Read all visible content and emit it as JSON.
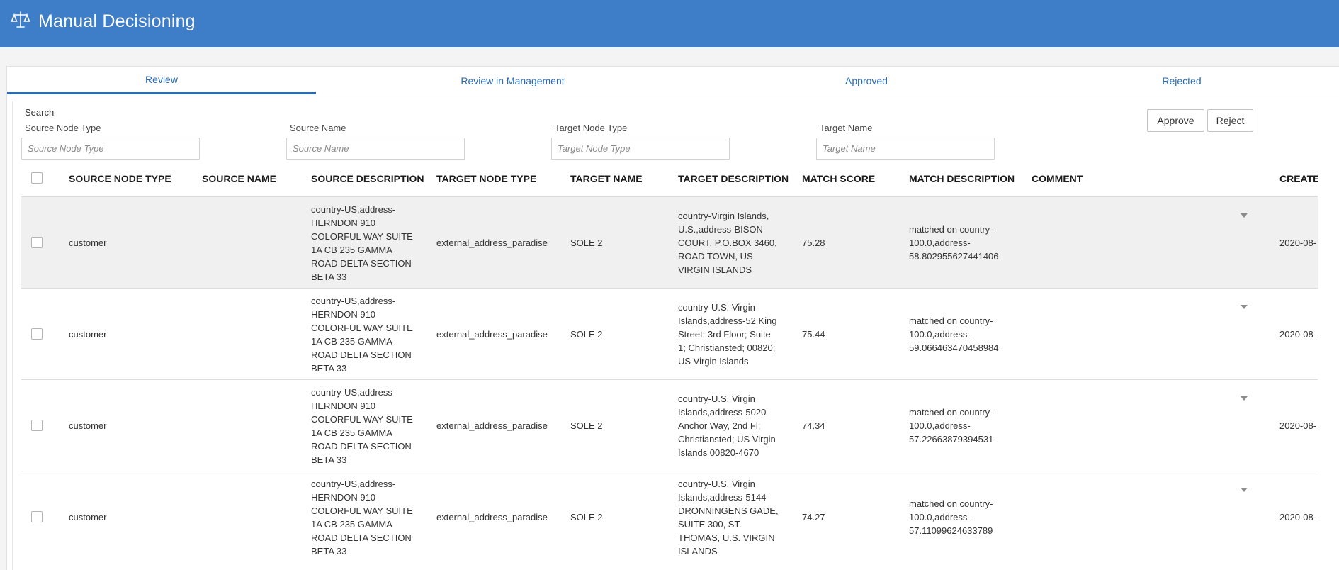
{
  "header": {
    "title": "Manual Decisioning",
    "logo_icon": "scales-icon",
    "background_color": "#3e7ec9"
  },
  "tabs": [
    {
      "label": "Review",
      "active": true
    },
    {
      "label": "Review in Management",
      "active": false
    },
    {
      "label": "Approved",
      "active": false
    },
    {
      "label": "Rejected",
      "active": false
    }
  ],
  "search": {
    "label": "Search",
    "fields": [
      {
        "label": "Source Node Type",
        "placeholder": "Source Node Type",
        "value": ""
      },
      {
        "label": "Source Name",
        "placeholder": "Source Name",
        "value": ""
      },
      {
        "label": "Target Node Type",
        "placeholder": "Target Node Type",
        "value": ""
      },
      {
        "label": "Target Name",
        "placeholder": "Target Name",
        "value": ""
      }
    ]
  },
  "actions": {
    "approve_label": "Approve",
    "reject_label": "Reject"
  },
  "table": {
    "columns": [
      "SOURCE NODE TYPE",
      "SOURCE NAME",
      "SOURCE DESCRIPTION",
      "TARGET NODE TYPE",
      "TARGET NAME",
      "TARGET DESCRIPTION",
      "MATCH SCORE",
      "MATCH DESCRIPTION",
      "COMMENT",
      "CREATED"
    ],
    "rows": [
      {
        "source_node_type": "customer",
        "source_name": "",
        "source_description": [
          "country-US,address-",
          "HERNDON 910",
          "COLORFUL WAY SUITE",
          "1A CB 235 GAMMA",
          "ROAD DELTA SECTION",
          "BETA 33"
        ],
        "target_node_type": "external_address_paradise",
        "target_name": "SOLE 2",
        "target_description": [
          "country-Virgin Islands,",
          "U.S.,address-BISON",
          "COURT, P.O.BOX 3460,",
          "ROAD TOWN, US",
          "VIRGIN ISLANDS"
        ],
        "match_score": "75.28",
        "match_description": [
          "matched on country-",
          "100.0,address-",
          "58.802955627441406"
        ],
        "comment": "",
        "created": "2020-08-"
      },
      {
        "source_node_type": "customer",
        "source_name": "",
        "source_description": [
          "country-US,address-",
          "HERNDON 910",
          "COLORFUL WAY SUITE",
          "1A CB 235 GAMMA",
          "ROAD DELTA SECTION",
          "BETA 33"
        ],
        "target_node_type": "external_address_paradise",
        "target_name": "SOLE 2",
        "target_description": [
          "country-U.S. Virgin",
          "Islands,address-52 King",
          "Street; 3rd Floor; Suite",
          "1; Christiansted; 00820;",
          "US Virgin Islands"
        ],
        "match_score": "75.44",
        "match_description": [
          "matched on country-",
          "100.0,address-",
          "59.066463470458984"
        ],
        "comment": "",
        "created": "2020-08-"
      },
      {
        "source_node_type": "customer",
        "source_name": "",
        "source_description": [
          "country-US,address-",
          "HERNDON 910",
          "COLORFUL WAY SUITE",
          "1A CB 235 GAMMA",
          "ROAD DELTA SECTION",
          "BETA 33"
        ],
        "target_node_type": "external_address_paradise",
        "target_name": "SOLE 2",
        "target_description": [
          "country-U.S. Virgin",
          "Islands,address-5020",
          "Anchor Way, 2nd Fl;",
          "Christiansted; US Virgin",
          "Islands 00820-4670"
        ],
        "match_score": "74.34",
        "match_description": [
          "matched on country-",
          "100.0,address-",
          "57.22663879394531"
        ],
        "comment": "",
        "created": "2020-08-"
      },
      {
        "source_node_type": "customer",
        "source_name": "",
        "source_description": [
          "country-US,address-",
          "HERNDON 910",
          "COLORFUL WAY SUITE",
          "1A CB 235 GAMMA",
          "ROAD DELTA SECTION",
          "BETA 33"
        ],
        "target_node_type": "external_address_paradise",
        "target_name": "SOLE 2",
        "target_description": [
          "country-U.S. Virgin",
          "Islands,address-5144",
          "DRONNINGENS GADE,",
          "SUITE 300, ST.",
          "THOMAS, U.S. VIRGIN",
          "ISLANDS"
        ],
        "match_score": "74.27",
        "match_description": [
          "matched on country-",
          "100.0,address-",
          "57.11099624633789"
        ],
        "comment": "",
        "created": "2020-08-"
      }
    ]
  }
}
